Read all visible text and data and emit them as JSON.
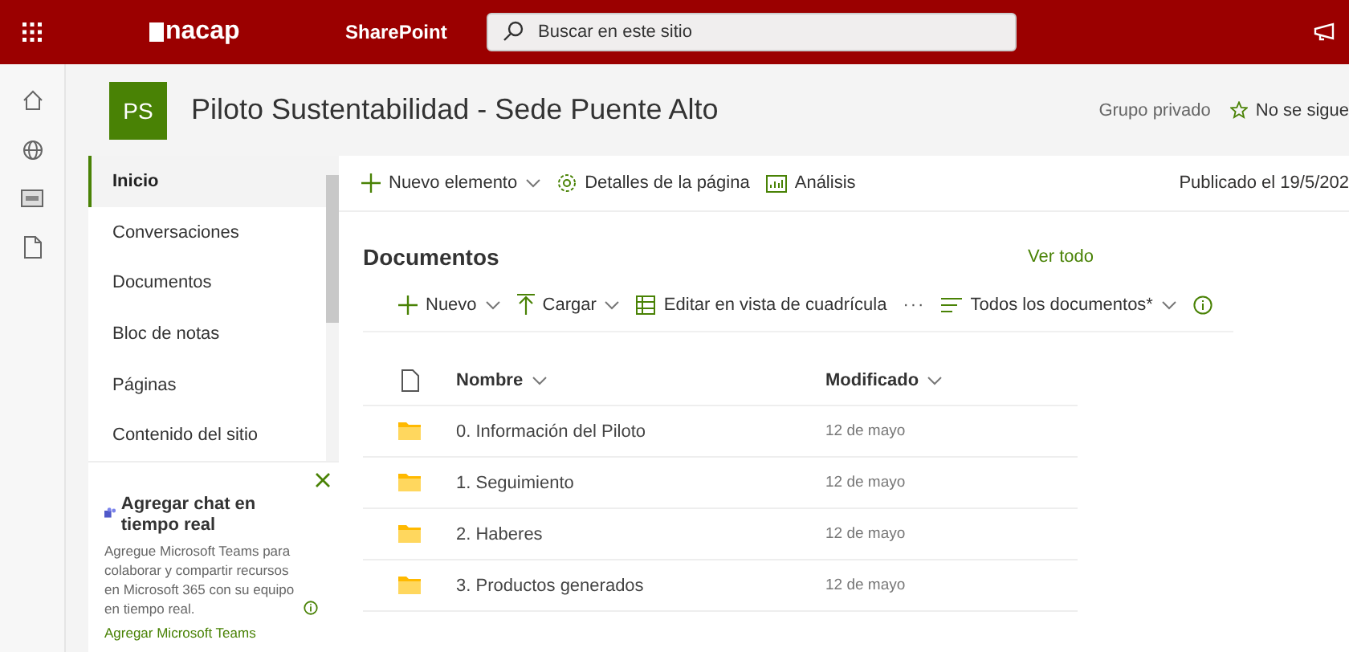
{
  "top_bar": {
    "logo": "nacap",
    "app": "SharePoint",
    "search": {
      "placeholder": "Buscar en este sitio"
    }
  },
  "site": {
    "initials": "PS",
    "title": "Piloto Sustentabilidad - Sede Puente Alto",
    "privacy": "Grupo privado",
    "follow": "No se sigue"
  },
  "nav": {
    "items": [
      {
        "label": "Inicio",
        "selected": true
      },
      {
        "label": "Conversaciones",
        "selected": false
      },
      {
        "label": "Documentos",
        "selected": false
      },
      {
        "label": "Bloc de notas",
        "selected": false
      },
      {
        "label": "Páginas",
        "selected": false
      },
      {
        "label": "Contenido del sitio",
        "selected": false
      }
    ]
  },
  "teams_panel": {
    "title": "Agregar chat en tiempo real",
    "text": "Agregue Microsoft Teams para colaborar y compartir recursos en Microsoft 365 con su equipo en tiempo real.",
    "link": "Agregar Microsoft Teams"
  },
  "page_toolbar": {
    "items": [
      {
        "kind": "new",
        "label": "Nuevo elemento"
      },
      {
        "kind": "details",
        "label": "Detalles de la página"
      },
      {
        "kind": "analytics",
        "label": "Análisis"
      }
    ],
    "published": "Publicado el 19/5/202"
  },
  "documents": {
    "title": "Documentos",
    "see_all": "Ver todo",
    "commands": [
      {
        "kind": "new",
        "label": "Nuevo"
      },
      {
        "kind": "upload",
        "label": "Cargar"
      },
      {
        "kind": "grid",
        "label": "Editar en vista de cuadrícula"
      },
      {
        "kind": "more",
        "label": "···"
      },
      {
        "kind": "view",
        "label": "Todos los documentos*"
      },
      {
        "kind": "info"
      }
    ],
    "columns": [
      "Nombre",
      "Modificado"
    ],
    "rows": [
      {
        "name": "0. Información del Piloto",
        "modified": "12 de mayo"
      },
      {
        "name": "1. Seguimiento",
        "modified": "12 de mayo"
      },
      {
        "name": "2. Haberes",
        "modified": "12 de mayo"
      },
      {
        "name": "3. Productos generados",
        "modified": "12 de mayo"
      }
    ]
  }
}
